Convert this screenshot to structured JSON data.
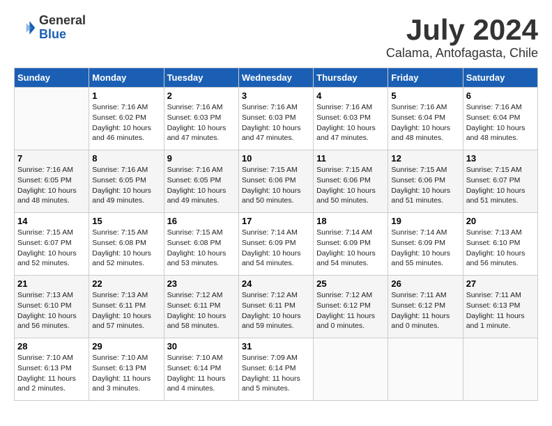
{
  "logo": {
    "general": "General",
    "blue": "Blue"
  },
  "title": "July 2024",
  "location": "Calama, Antofagasta, Chile",
  "days_of_week": [
    "Sunday",
    "Monday",
    "Tuesday",
    "Wednesday",
    "Thursday",
    "Friday",
    "Saturday"
  ],
  "weeks": [
    [
      {
        "day": "",
        "info": ""
      },
      {
        "day": "1",
        "info": "Sunrise: 7:16 AM\nSunset: 6:02 PM\nDaylight: 10 hours\nand 46 minutes."
      },
      {
        "day": "2",
        "info": "Sunrise: 7:16 AM\nSunset: 6:03 PM\nDaylight: 10 hours\nand 47 minutes."
      },
      {
        "day": "3",
        "info": "Sunrise: 7:16 AM\nSunset: 6:03 PM\nDaylight: 10 hours\nand 47 minutes."
      },
      {
        "day": "4",
        "info": "Sunrise: 7:16 AM\nSunset: 6:03 PM\nDaylight: 10 hours\nand 47 minutes."
      },
      {
        "day": "5",
        "info": "Sunrise: 7:16 AM\nSunset: 6:04 PM\nDaylight: 10 hours\nand 48 minutes."
      },
      {
        "day": "6",
        "info": "Sunrise: 7:16 AM\nSunset: 6:04 PM\nDaylight: 10 hours\nand 48 minutes."
      }
    ],
    [
      {
        "day": "7",
        "info": "Sunrise: 7:16 AM\nSunset: 6:05 PM\nDaylight: 10 hours\nand 48 minutes."
      },
      {
        "day": "8",
        "info": "Sunrise: 7:16 AM\nSunset: 6:05 PM\nDaylight: 10 hours\nand 49 minutes."
      },
      {
        "day": "9",
        "info": "Sunrise: 7:16 AM\nSunset: 6:05 PM\nDaylight: 10 hours\nand 49 minutes."
      },
      {
        "day": "10",
        "info": "Sunrise: 7:15 AM\nSunset: 6:06 PM\nDaylight: 10 hours\nand 50 minutes."
      },
      {
        "day": "11",
        "info": "Sunrise: 7:15 AM\nSunset: 6:06 PM\nDaylight: 10 hours\nand 50 minutes."
      },
      {
        "day": "12",
        "info": "Sunrise: 7:15 AM\nSunset: 6:06 PM\nDaylight: 10 hours\nand 51 minutes."
      },
      {
        "day": "13",
        "info": "Sunrise: 7:15 AM\nSunset: 6:07 PM\nDaylight: 10 hours\nand 51 minutes."
      }
    ],
    [
      {
        "day": "14",
        "info": "Sunrise: 7:15 AM\nSunset: 6:07 PM\nDaylight: 10 hours\nand 52 minutes."
      },
      {
        "day": "15",
        "info": "Sunrise: 7:15 AM\nSunset: 6:08 PM\nDaylight: 10 hours\nand 52 minutes."
      },
      {
        "day": "16",
        "info": "Sunrise: 7:15 AM\nSunset: 6:08 PM\nDaylight: 10 hours\nand 53 minutes."
      },
      {
        "day": "17",
        "info": "Sunrise: 7:14 AM\nSunset: 6:09 PM\nDaylight: 10 hours\nand 54 minutes."
      },
      {
        "day": "18",
        "info": "Sunrise: 7:14 AM\nSunset: 6:09 PM\nDaylight: 10 hours\nand 54 minutes."
      },
      {
        "day": "19",
        "info": "Sunrise: 7:14 AM\nSunset: 6:09 PM\nDaylight: 10 hours\nand 55 minutes."
      },
      {
        "day": "20",
        "info": "Sunrise: 7:13 AM\nSunset: 6:10 PM\nDaylight: 10 hours\nand 56 minutes."
      }
    ],
    [
      {
        "day": "21",
        "info": "Sunrise: 7:13 AM\nSunset: 6:10 PM\nDaylight: 10 hours\nand 56 minutes."
      },
      {
        "day": "22",
        "info": "Sunrise: 7:13 AM\nSunset: 6:11 PM\nDaylight: 10 hours\nand 57 minutes."
      },
      {
        "day": "23",
        "info": "Sunrise: 7:12 AM\nSunset: 6:11 PM\nDaylight: 10 hours\nand 58 minutes."
      },
      {
        "day": "24",
        "info": "Sunrise: 7:12 AM\nSunset: 6:11 PM\nDaylight: 10 hours\nand 59 minutes."
      },
      {
        "day": "25",
        "info": "Sunrise: 7:12 AM\nSunset: 6:12 PM\nDaylight: 11 hours\nand 0 minutes."
      },
      {
        "day": "26",
        "info": "Sunrise: 7:11 AM\nSunset: 6:12 PM\nDaylight: 11 hours\nand 0 minutes."
      },
      {
        "day": "27",
        "info": "Sunrise: 7:11 AM\nSunset: 6:13 PM\nDaylight: 11 hours\nand 1 minute."
      }
    ],
    [
      {
        "day": "28",
        "info": "Sunrise: 7:10 AM\nSunset: 6:13 PM\nDaylight: 11 hours\nand 2 minutes."
      },
      {
        "day": "29",
        "info": "Sunrise: 7:10 AM\nSunset: 6:13 PM\nDaylight: 11 hours\nand 3 minutes."
      },
      {
        "day": "30",
        "info": "Sunrise: 7:10 AM\nSunset: 6:14 PM\nDaylight: 11 hours\nand 4 minutes."
      },
      {
        "day": "31",
        "info": "Sunrise: 7:09 AM\nSunset: 6:14 PM\nDaylight: 11 hours\nand 5 minutes."
      },
      {
        "day": "",
        "info": ""
      },
      {
        "day": "",
        "info": ""
      },
      {
        "day": "",
        "info": ""
      }
    ]
  ]
}
